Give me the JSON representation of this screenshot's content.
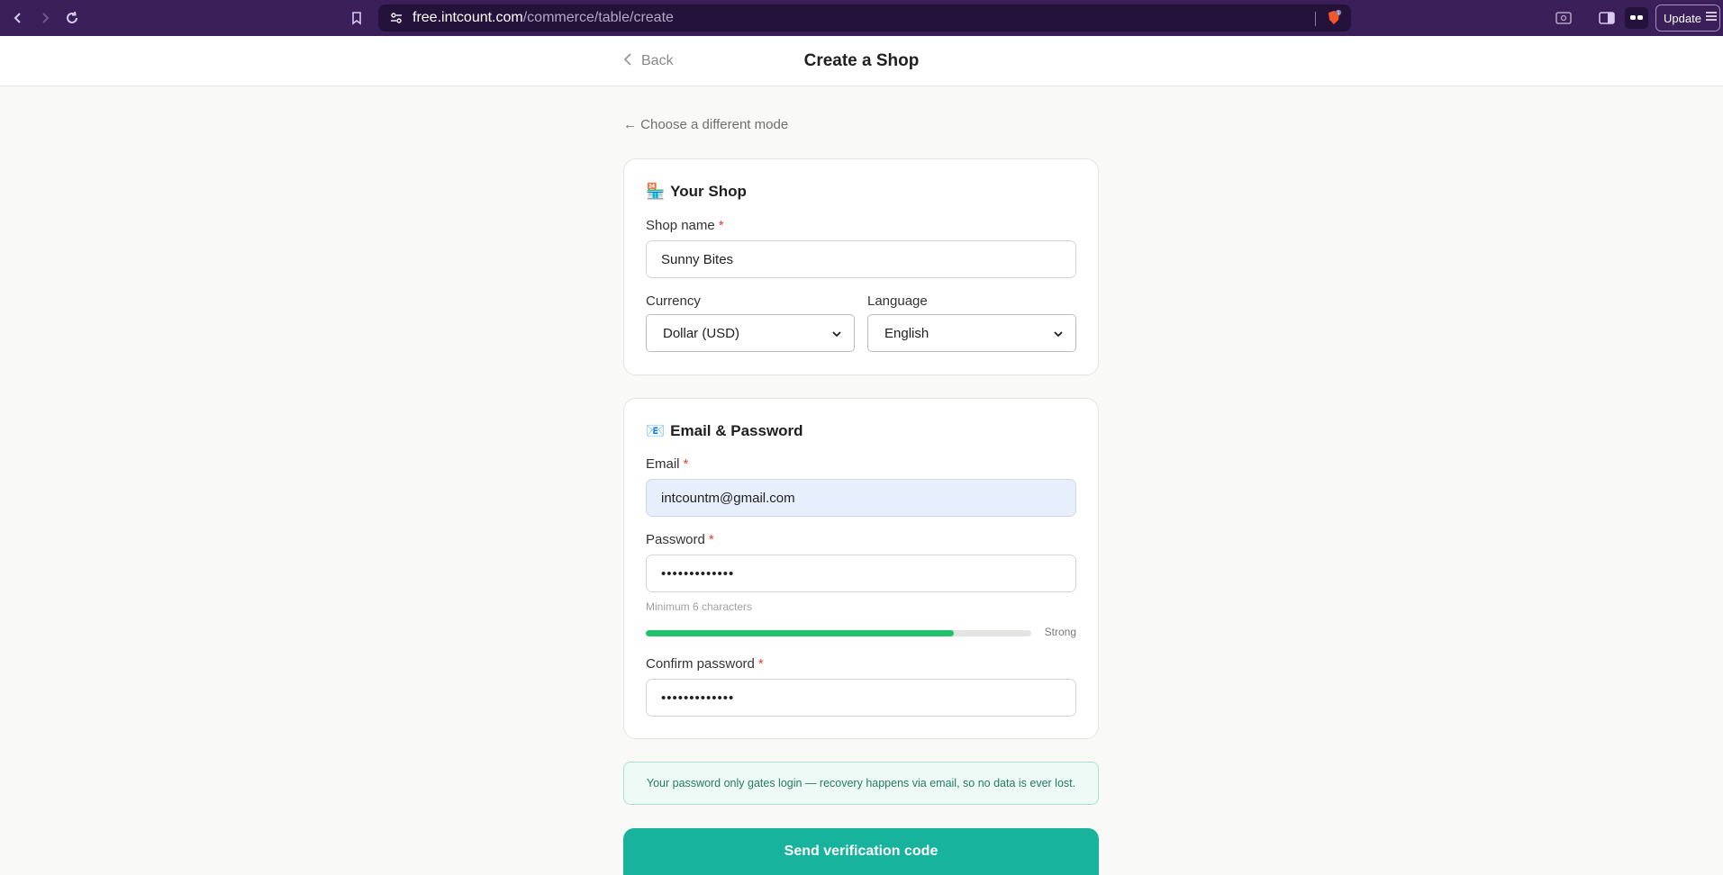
{
  "browser": {
    "url_host": "free.intcount.com",
    "url_path": "/commerce/table/create",
    "update_label": "Update",
    "brave_badge": "1"
  },
  "header": {
    "back_label": "Back",
    "title": "Create a Shop"
  },
  "choose_mode": "← Choose a different mode",
  "shop_section": {
    "emoji": "🏪",
    "title": "Your Shop",
    "shop_name_label": "Shop name",
    "shop_name_value": "Sunny Bites",
    "currency_label": "Currency",
    "currency_value": "Dollar (USD)",
    "language_label": "Language",
    "language_value": "English"
  },
  "auth_section": {
    "emoji": "📧",
    "title": "Email & Password",
    "email_label": "Email",
    "email_value": "intcountm@gmail.com",
    "password_label": "Password",
    "password_value": "•••••••••••••",
    "password_hint": "Minimum 6 characters",
    "strength_label": "Strong",
    "strength_fraction": 0.8,
    "confirm_label": "Confirm password",
    "confirm_value": "•••••••••••••"
  },
  "required_marker": "*",
  "info_text": "Your password only gates login — recovery happens via email, so no data is ever lost.",
  "send_button": "Send verification code",
  "colors": {
    "browser_bg": "#3b1f58",
    "accent": "#17b39c",
    "strength": "#22c16b",
    "required": "#e0413a"
  }
}
